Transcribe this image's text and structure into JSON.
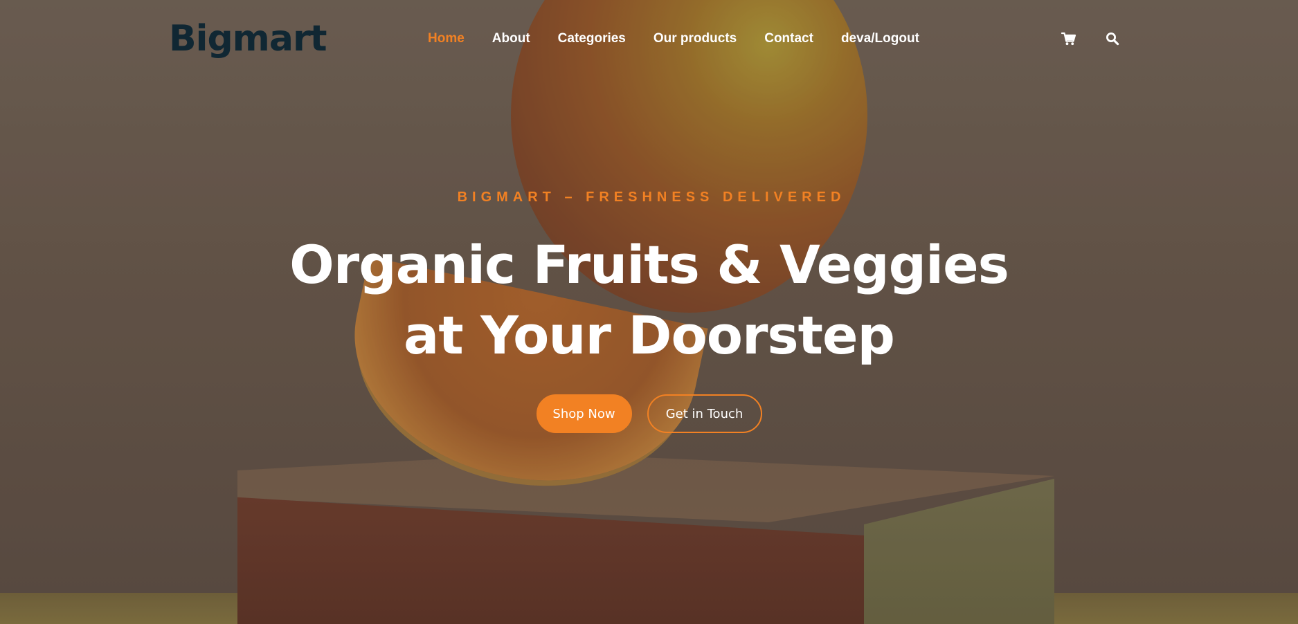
{
  "header": {
    "logo": "Bigmart",
    "nav": [
      {
        "label": "Home",
        "active": true
      },
      {
        "label": "About",
        "active": false
      },
      {
        "label": "Categories",
        "active": false
      },
      {
        "label": "Our products",
        "active": false
      },
      {
        "label": "Contact",
        "active": false
      },
      {
        "label": "deva/Logout",
        "active": false
      }
    ],
    "icons": [
      "cart-icon",
      "search-icon"
    ]
  },
  "hero": {
    "subtitle": "BIGMART – FRESHNESS DELIVERED",
    "title_line1": "Organic Fruits & Veggies",
    "title_line2": "at Your Doorstep",
    "primary_button": "Shop Now",
    "secondary_button": "Get in Touch"
  },
  "colors": {
    "accent": "#f28123",
    "logo": "#102733",
    "text_light": "#ffffff"
  }
}
